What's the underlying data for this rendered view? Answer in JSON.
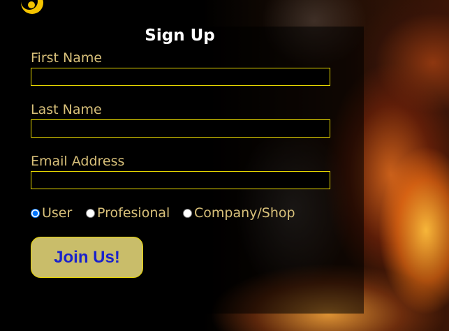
{
  "form": {
    "title": "Sign Up",
    "first_name": {
      "label": "First Name",
      "value": ""
    },
    "last_name": {
      "label": "Last Name",
      "value": ""
    },
    "email": {
      "label": "Email Address",
      "value": ""
    },
    "account_types": [
      {
        "label": "User",
        "selected": true
      },
      {
        "label": "Profesional",
        "selected": false
      },
      {
        "label": "Company/Shop",
        "selected": false
      }
    ],
    "submit_label": "Join Us!"
  },
  "colors": {
    "label_text": "#d8c07a",
    "field_border": "#e8d800",
    "button_bg": "#c9bd6a",
    "button_text": "#1a22cc",
    "logo": "#f5c400"
  },
  "icons": {
    "logo": "crescent-logo-icon"
  }
}
